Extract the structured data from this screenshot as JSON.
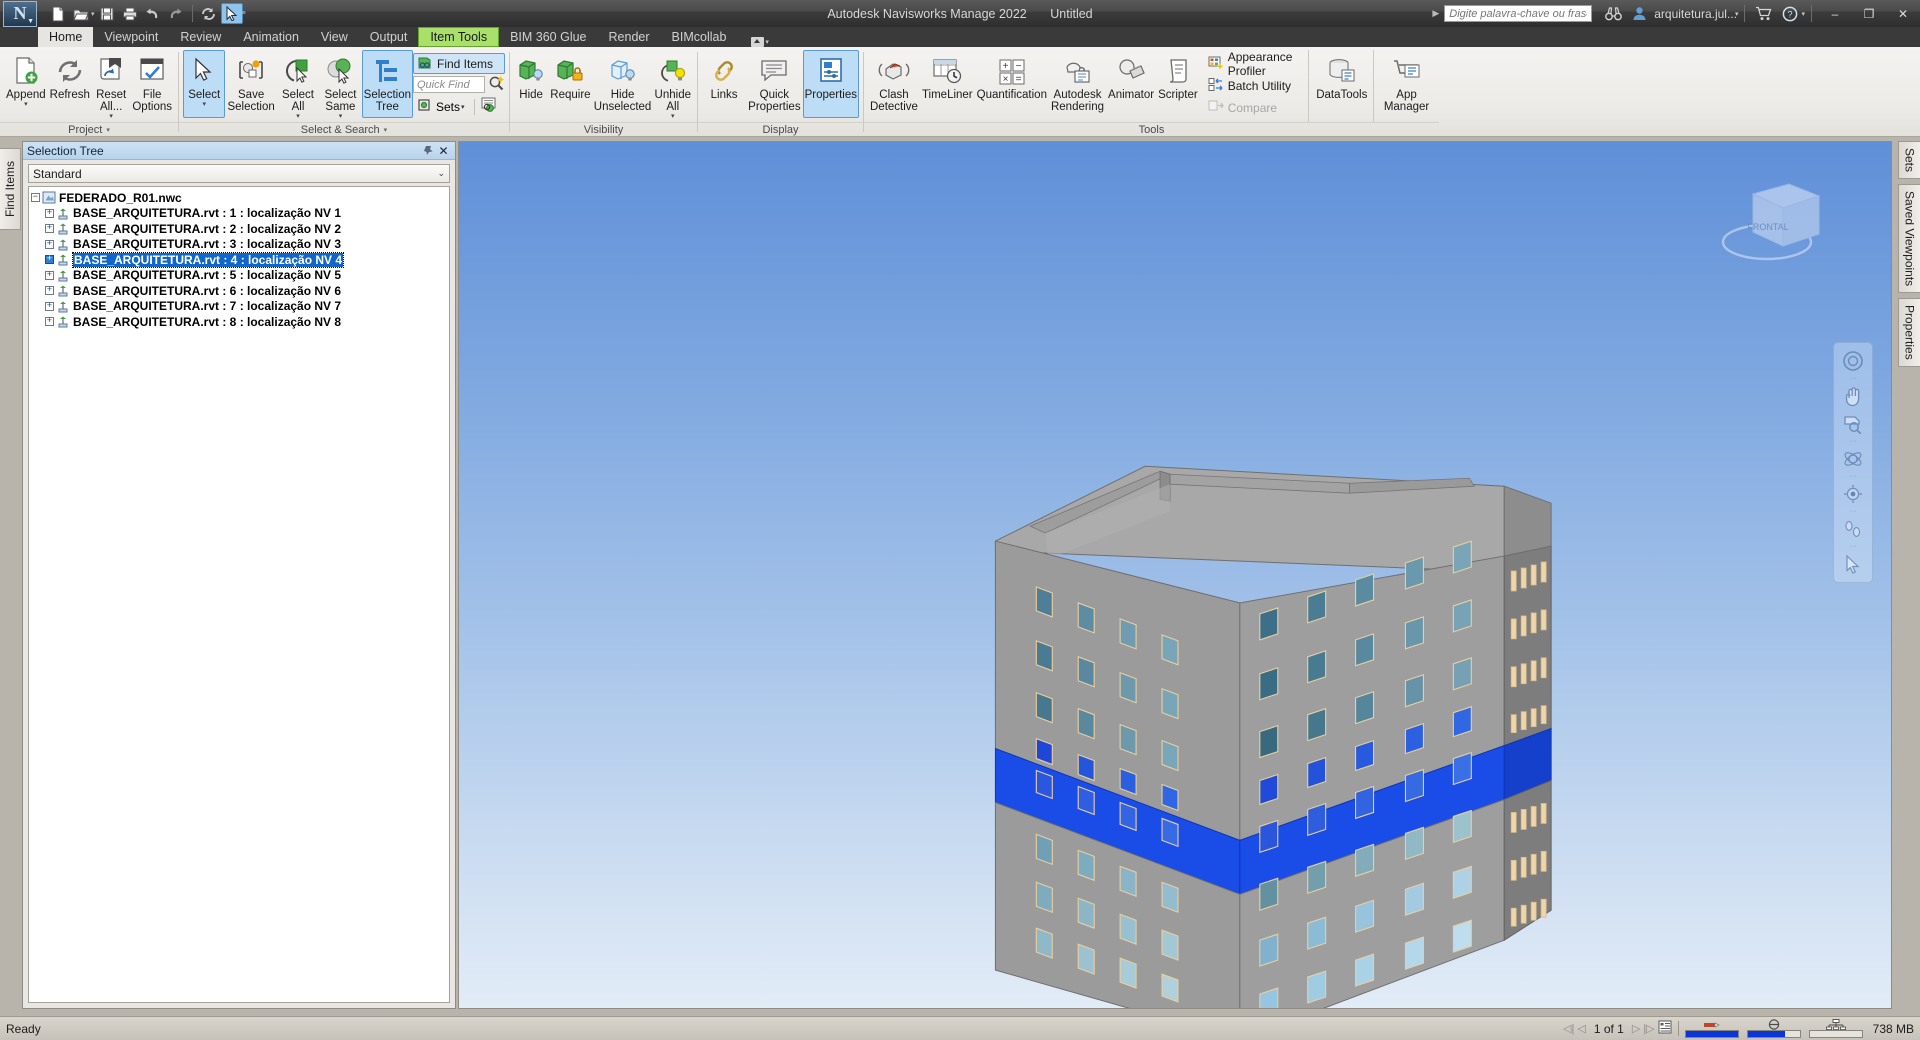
{
  "titlebar": {
    "app_title": "Autodesk Navisworks Manage 2022",
    "document_title": "Untitled",
    "search_placeholder": "Digite palavra-chave ou frase",
    "user_name": "arquitetura.jul...",
    "qat": [
      {
        "name": "new",
        "label": "New"
      },
      {
        "name": "open",
        "label": "Open"
      },
      {
        "name": "save",
        "label": "Save"
      },
      {
        "name": "print",
        "label": "Print"
      },
      {
        "name": "undo",
        "label": "Undo"
      },
      {
        "name": "redo",
        "label": "Redo"
      },
      {
        "name": "refresh",
        "label": "Refresh"
      },
      {
        "name": "select",
        "label": "Select"
      }
    ],
    "window_buttons": {
      "minimize": "–",
      "restore": "❐",
      "close": "✕"
    }
  },
  "tabs": [
    {
      "label": "Home",
      "state": "active"
    },
    {
      "label": "Viewpoint",
      "state": "normal"
    },
    {
      "label": "Review",
      "state": "normal"
    },
    {
      "label": "Animation",
      "state": "normal"
    },
    {
      "label": "View",
      "state": "normal"
    },
    {
      "label": "Output",
      "state": "normal"
    },
    {
      "label": "Item Tools",
      "state": "contextual"
    },
    {
      "label": "BIM 360 Glue",
      "state": "normal"
    },
    {
      "label": "Render",
      "state": "normal"
    },
    {
      "label": "BIMcollab",
      "state": "normal"
    }
  ],
  "ribbon": {
    "project": {
      "title": "Project",
      "buttons": [
        {
          "label": "Append",
          "icon": "append-icon",
          "dropdown": true
        },
        {
          "label": "Refresh",
          "icon": "refresh-icon",
          "dropdown": false
        },
        {
          "label": "Reset\nAll...",
          "line1": "Reset",
          "line2": "All...",
          "icon": "reset-all-icon",
          "dropdown": true
        },
        {
          "label": "File\nOptions",
          "line1": "File",
          "line2": "Options",
          "icon": "file-options-icon",
          "dropdown": false
        }
      ]
    },
    "select_search": {
      "title": "Select & Search",
      "buttons": [
        {
          "line1": "Select",
          "line2": "",
          "icon": "select-arrow-icon",
          "selected": true,
          "dropdown": true
        },
        {
          "line1": "Save",
          "line2": "Selection",
          "icon": "save-selection-icon",
          "selected": false,
          "dropdown": false
        },
        {
          "line1": "Select",
          "line2": "All",
          "icon": "select-all-icon",
          "selected": false,
          "dropdown": true
        },
        {
          "line1": "Select",
          "line2": "Same",
          "icon": "select-same-icon",
          "selected": false,
          "dropdown": true
        },
        {
          "line1": "Selection",
          "line2": "Tree",
          "icon": "selection-tree-icon",
          "selected": true,
          "dropdown": false
        }
      ],
      "find_items_label": "Find Items",
      "quick_find_placeholder": "Quick Find",
      "sets_label": "Sets"
    },
    "visibility": {
      "title": "Visibility",
      "buttons": [
        {
          "line1": "Hide",
          "line2": "",
          "icon": "hide-icon",
          "dropdown": false
        },
        {
          "line1": "Require",
          "line2": "",
          "icon": "require-icon",
          "dropdown": false
        },
        {
          "line1": "Hide",
          "line2": "Unselected",
          "icon": "hide-unselected-icon",
          "dropdown": false
        },
        {
          "line1": "Unhide",
          "line2": "All",
          "icon": "unhide-all-icon",
          "dropdown": true
        }
      ]
    },
    "display": {
      "title": "Display",
      "buttons": [
        {
          "line1": "Links",
          "line2": "",
          "icon": "links-icon",
          "selected": false
        },
        {
          "line1": "Quick",
          "line2": "Properties",
          "icon": "quick-properties-icon",
          "selected": false
        },
        {
          "line1": "Properties",
          "line2": "",
          "icon": "properties-icon",
          "selected": true
        }
      ]
    },
    "tools": {
      "title": "Tools",
      "buttons": [
        {
          "line1": "Clash",
          "line2": "Detective",
          "icon": "clash-detective-icon"
        },
        {
          "line1": "TimeLiner",
          "line2": "",
          "icon": "timeliner-icon"
        },
        {
          "line1": "Quantification",
          "line2": "",
          "icon": "quantification-icon"
        },
        {
          "line1": "Autodesk",
          "line2": "Rendering",
          "icon": "autodesk-rendering-icon"
        },
        {
          "line1": "Animator",
          "line2": "",
          "icon": "animator-icon"
        },
        {
          "line1": "Scripter",
          "line2": "",
          "icon": "scripter-icon"
        }
      ],
      "small_buttons": [
        {
          "label": "Appearance Profiler",
          "icon": "appearance-profiler-icon",
          "disabled": false
        },
        {
          "label": "Batch Utility",
          "icon": "batch-utility-icon",
          "disabled": false
        },
        {
          "label": "Compare",
          "icon": "compare-icon",
          "disabled": true
        }
      ],
      "right_buttons": [
        {
          "line1": "DataTools",
          "line2": "",
          "icon": "datatools-icon"
        },
        {
          "line1": "App Manager",
          "line2": "",
          "icon": "app-manager-icon"
        }
      ]
    }
  },
  "left_tab": {
    "label": "Find Items"
  },
  "selection_tree": {
    "panel_title": "Selection Tree",
    "dropdown_value": "Standard",
    "root": {
      "label": "FEDERADO_R01.nwc",
      "expanded": true
    },
    "items": [
      {
        "label": "BASE_ARQUITETURA.rvt : 1 : localização NV 1",
        "selected": false
      },
      {
        "label": "BASE_ARQUITETURA.rvt : 2 : localização NV 2",
        "selected": false
      },
      {
        "label": "BASE_ARQUITETURA.rvt : 3 : localização NV 3",
        "selected": false
      },
      {
        "label": "BASE_ARQUITETURA.rvt : 4 : localização NV 4",
        "selected": true
      },
      {
        "label": "BASE_ARQUITETURA.rvt : 5 : localização NV 5",
        "selected": false
      },
      {
        "label": "BASE_ARQUITETURA.rvt : 6 : localização NV 6",
        "selected": false
      },
      {
        "label": "BASE_ARQUITETURA.rvt : 7 : localização NV 7",
        "selected": false
      },
      {
        "label": "BASE_ARQUITETURA.rvt : 8 : localização NV 8",
        "selected": false
      }
    ]
  },
  "viewport": {
    "viewcube_label": "FRONTAL",
    "model": {
      "description": "3D building model - 8 storeys, gray facade, level 4 highlighted blue",
      "facade_color": "#9a9a9a",
      "side_color": "#787878",
      "roof_color": "#a5a5a5",
      "selected_floor_color": "#1645e8",
      "window_color": "#5e8fa8"
    },
    "nav_buttons": [
      {
        "name": "steering-wheel-icon",
        "label": "Steering Wheels"
      },
      {
        "name": "pan-hand-icon",
        "label": "Pan"
      },
      {
        "name": "zoom-window-icon",
        "label": "Zoom"
      },
      {
        "name": "orbit-icon",
        "label": "Orbit"
      },
      {
        "name": "look-around-icon",
        "label": "Look Around"
      },
      {
        "name": "walk-icon",
        "label": "Walk"
      },
      {
        "name": "select-cursor-icon",
        "label": "Select"
      }
    ]
  },
  "right_tabs": [
    {
      "label": "Sets"
    },
    {
      "label": "Saved Viewpoints"
    },
    {
      "label": "Properties"
    }
  ],
  "statusbar": {
    "status_text": "Ready",
    "page_label": "1 of 1",
    "memory": "738 MB",
    "progress": [
      {
        "name": "drawing-progress",
        "value": 100,
        "icon": "pencil-icon"
      },
      {
        "name": "server-progress",
        "value": 72,
        "icon": "disk-icon"
      },
      {
        "name": "network-progress",
        "value": 0,
        "icon": "network-icon"
      }
    ]
  }
}
